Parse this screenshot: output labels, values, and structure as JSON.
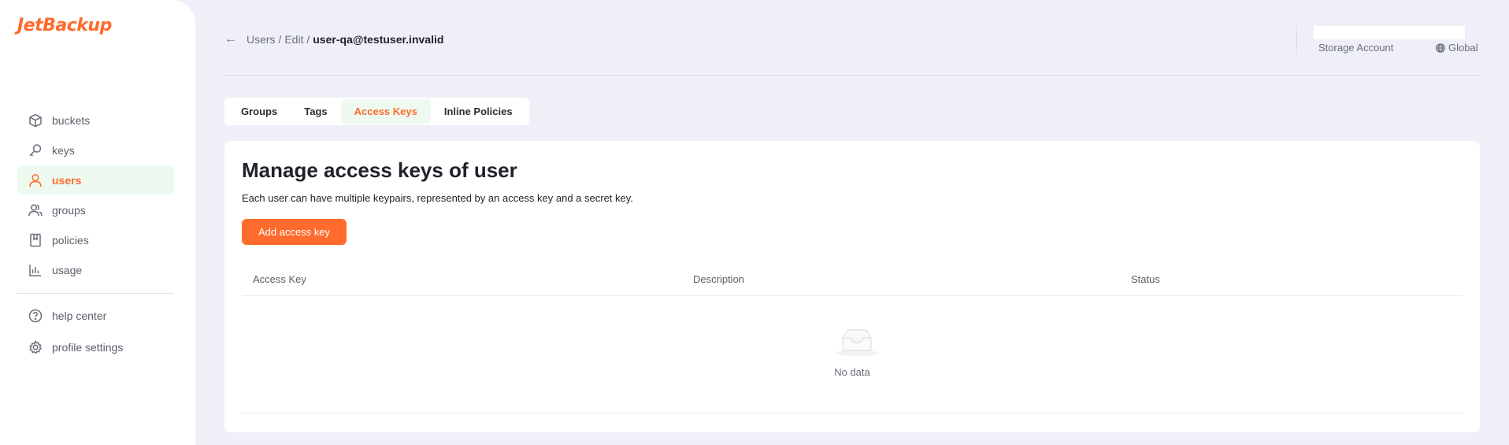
{
  "app": {
    "logo": "JetBackup"
  },
  "sidebar": {
    "items": [
      {
        "label": "buckets",
        "icon": "cube-icon",
        "active": false
      },
      {
        "label": "keys",
        "icon": "key-icon",
        "active": false
      },
      {
        "label": "users",
        "icon": "user-icon",
        "active": true
      },
      {
        "label": "groups",
        "icon": "users-icon",
        "active": false
      },
      {
        "label": "policies",
        "icon": "document-icon",
        "active": false
      },
      {
        "label": "usage",
        "icon": "bar-chart-icon",
        "active": false
      }
    ],
    "bottom_items": [
      {
        "label": "help center",
        "icon": "help-icon"
      },
      {
        "label": "profile settings",
        "icon": "gear-icon"
      }
    ]
  },
  "header": {
    "back_icon": "arrow-left-icon",
    "breadcrumb": [
      "Users /",
      "Edit /"
    ],
    "current": "user-qa@testuser.invalid",
    "account_label": "Storage Account",
    "region": "Global",
    "region_icon": "globe-icon"
  },
  "tabs": [
    {
      "label": "Groups",
      "active": false
    },
    {
      "label": "Tags",
      "active": false
    },
    {
      "label": "Access Keys",
      "active": true
    },
    {
      "label": "Inline Policies",
      "active": false
    }
  ],
  "main": {
    "title": "Manage access keys of user",
    "description": "Each user can have multiple keypairs, represented by an access key and a secret key.",
    "add_button": "Add access key",
    "table": {
      "columns": [
        "Access Key",
        "Description",
        "Status"
      ],
      "rows": [],
      "empty_text": "No data",
      "empty_icon": "inbox-icon"
    }
  },
  "colors": {
    "accent": "#ff6b2c",
    "active_bg": "#eefaf0",
    "page_bg": "#eff0f7"
  }
}
